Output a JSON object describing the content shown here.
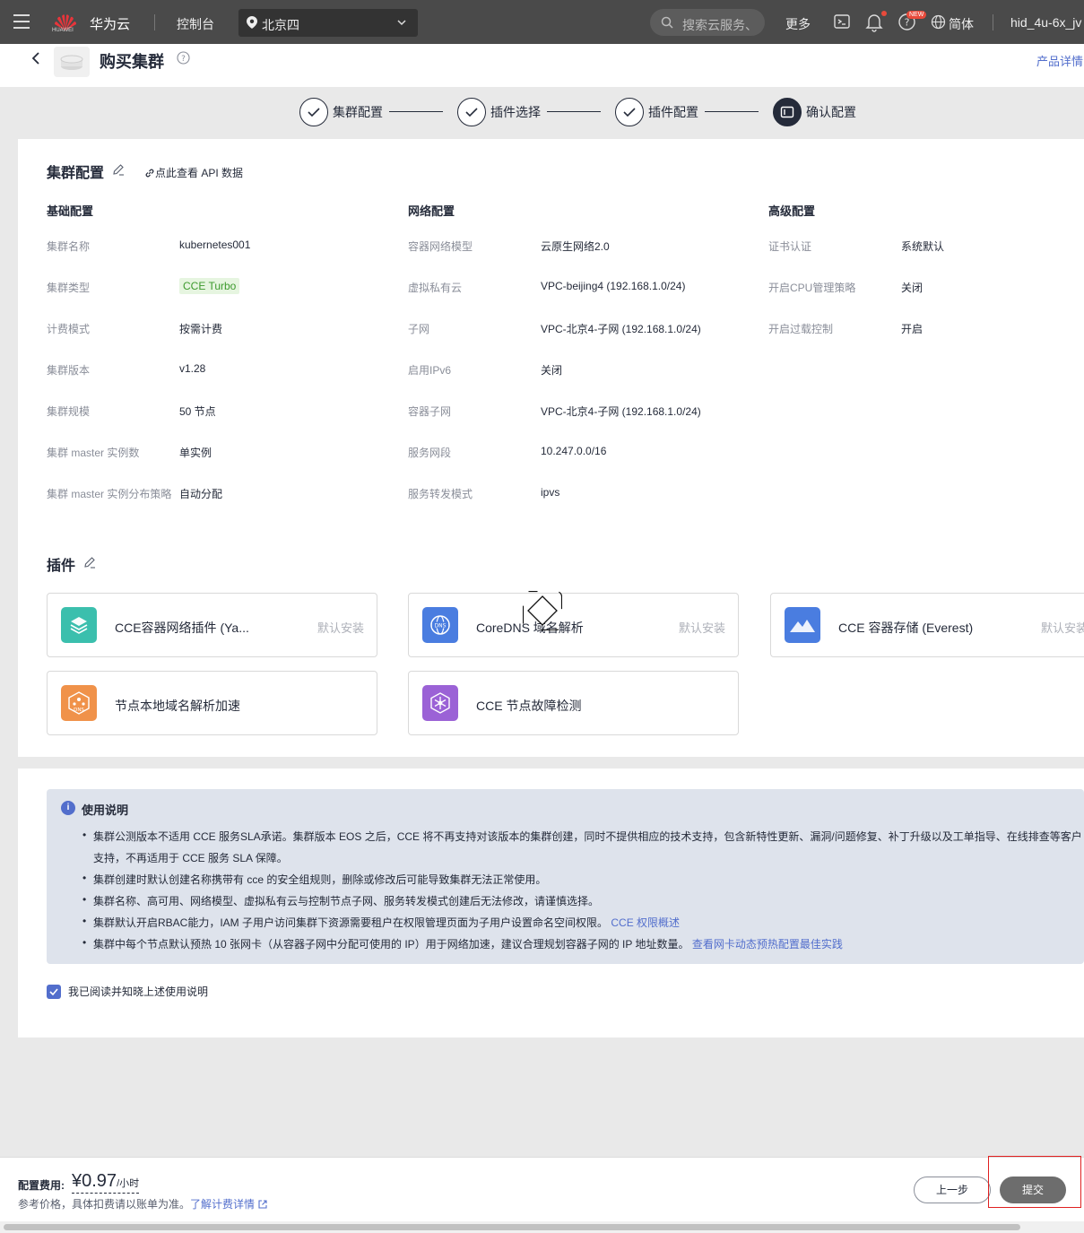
{
  "topbar": {
    "brand": "华为云",
    "logo_text": "HUAWEI",
    "console": "控制台",
    "region": "北京四",
    "search_placeholder": "搜索云服务、",
    "more": "更多",
    "new_badge": "NEW",
    "lang": "简体",
    "user": "hid_4u-6x_jv"
  },
  "titlebar": {
    "title": "购买集群",
    "product_link": "产品详情"
  },
  "steps": [
    {
      "label": "集群配置",
      "state": "done"
    },
    {
      "label": "插件选择",
      "state": "done"
    },
    {
      "label": "插件配置",
      "state": "done"
    },
    {
      "label": "确认配置",
      "state": "active"
    }
  ],
  "cluster": {
    "title": "集群配置",
    "api_link": "点此查看 API 数据",
    "basic": {
      "title": "基础配置",
      "rows": [
        {
          "label": "集群名称",
          "value": "kubernetes001"
        },
        {
          "label": "集群类型",
          "value": "CCE Turbo"
        },
        {
          "label": "计费模式",
          "value": "按需计费"
        },
        {
          "label": "集群版本",
          "value": "v1.28"
        },
        {
          "label": "集群规模",
          "value": "50 节点"
        },
        {
          "label": "集群 master 实例数",
          "value": "单实例"
        },
        {
          "label": "集群 master 实例分布策略",
          "value": "自动分配"
        }
      ]
    },
    "network": {
      "title": "网络配置",
      "rows": [
        {
          "label": "容器网络模型",
          "value": "云原生网络2.0"
        },
        {
          "label": "虚拟私有云",
          "value": "VPC-beijing4 (192.168.1.0/24)"
        },
        {
          "label": "子网",
          "value": "VPC-北京4-子网 (192.168.1.0/24)"
        },
        {
          "label": "启用IPv6",
          "value": "关闭"
        },
        {
          "label": "容器子网",
          "value": "VPC-北京4-子网 (192.168.1.0/24)"
        },
        {
          "label": "服务网段",
          "value": "10.247.0.0/16"
        },
        {
          "label": "服务转发模式",
          "value": "ipvs"
        }
      ]
    },
    "advanced": {
      "title": "高级配置",
      "rows": [
        {
          "label": "证书认证",
          "value": "系统默认"
        },
        {
          "label": "开启CPU管理策略",
          "value": "关闭"
        },
        {
          "label": "开启过载控制",
          "value": "开启"
        }
      ]
    }
  },
  "plugins": {
    "title": "插件",
    "items": [
      {
        "name": "CCE容器网络插件 (Ya...",
        "state": "默认安装",
        "icon": "network-plugin-icon",
        "color": "#3bbfad"
      },
      {
        "name": "CoreDNS 域名解析",
        "state": "默认安装",
        "icon": "dns-icon",
        "color": "#4a7de0"
      },
      {
        "name": "CCE 容器存储 (Everest)",
        "state": "默认安装",
        "icon": "storage-icon",
        "color": "#4a7de0"
      },
      {
        "name": "节点本地域名解析加速",
        "state": "",
        "icon": "local-dns-icon",
        "color": "#f0924a"
      },
      {
        "name": "CCE 节点故障检测",
        "state": "",
        "icon": "fault-detect-icon",
        "color": "#9b62d6"
      }
    ]
  },
  "notice": {
    "title": "使用说明",
    "items": [
      {
        "text": "集群公测版本不适用 CCE 服务SLA承诺。集群版本 EOS 之后，CCE 将不再支持对该版本的集群创建，同时不提供相应的技术支持，包含新特性更新、漏洞/问题修复、补丁升级以及工单指导、在线排查等客户",
        "cont": "支持，不再适用于 CCE 服务 SLA 保障。",
        "link": ""
      },
      {
        "text": "集群创建时默认创建名称携带有 cce 的安全组规则，删除或修改后可能导致集群无法正常使用。",
        "link": ""
      },
      {
        "text": "集群名称、高可用、网络模型、虚拟私有云与控制节点子网、服务转发模式创建后无法修改，请谨慎选择。",
        "link": ""
      },
      {
        "text": "集群默认开启RBAC能力，IAM 子用户访问集群下资源需要租户在权限管理页面为子用户设置命名空间权限。",
        "link": "CCE 权限概述"
      },
      {
        "text": "集群中每个节点默认预热 10 张网卡（从容器子网中分配可使用的 IP）用于网络加速，建议合理规划容器子网的 IP 地址数量。",
        "link": "查看网卡动态预热配置最佳实践"
      }
    ],
    "agree": "我已阅读并知晓上述使用说明"
  },
  "footer": {
    "fee_label": "配置费用:",
    "price": "¥0.97",
    "unit": "/小时",
    "note": "参考价格，具体扣费请以账单为准。",
    "note_link": "了解计费详情",
    "prev": "上一步",
    "submit": "提交"
  },
  "colors": {
    "accent": "#526ecc",
    "topbar": "#4a4a4a",
    "submit": "#6d6d6d",
    "highlight": "#e02020"
  }
}
